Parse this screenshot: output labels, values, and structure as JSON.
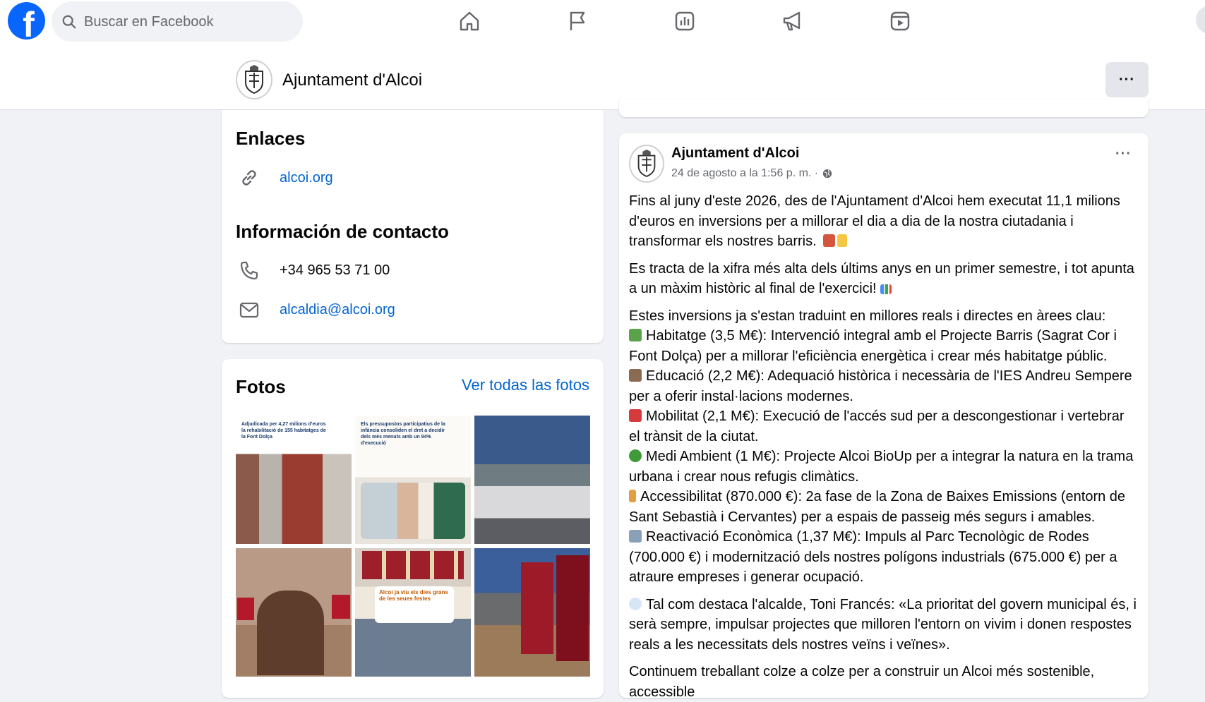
{
  "topbar": {
    "logo_letter": "f",
    "search_placeholder": "Buscar en Facebook",
    "nav_icons": [
      "home-icon",
      "flag-icon",
      "insights-icon",
      "megaphone-icon",
      "video-icon"
    ]
  },
  "page_header": {
    "name": "Ajuntament d'Alcoi",
    "more_label": "···"
  },
  "links_card": {
    "title": "Enlaces",
    "website": "alcoi.org",
    "contact_title": "Información de contacto",
    "phone": "+34 965 53 71 00",
    "email": "alcaldia@alcoi.org"
  },
  "photos_card": {
    "title": "Fotos",
    "see_all": "Ver todas las fotos",
    "photos": [
      {
        "caption": "Adjudicada per 4,27 milions d'euros la rehabilitació de 155 habitatges de la Font Dolça"
      },
      {
        "caption": "Els pressupostos participatius de la infància consoliden el dret a decidir dels més menuts amb un 94% d'execució"
      },
      {
        "caption": ""
      },
      {
        "caption": ""
      },
      {
        "caption": "Alcoi ja viu els dies grans de les seues festes"
      },
      {
        "caption": ""
      }
    ]
  },
  "post": {
    "author": "Ajuntament d'Alcoi",
    "date": "24 de agosto a la 1:56 p. m. ·",
    "more_label": "···",
    "paragraph1": "Fins al juny d'este 2026, des de l'Ajuntament d'Alcoi hem executat 11,1 milions d'euros en inversions per a millorar el dia a dia de la nostra ciutadania i transformar els nostres barris.",
    "paragraph2": "Es tracta de la xifra més alta dels últims anys en un primer semestre, i tot apunta a un màxim històric al final de l'exercici!",
    "intro": "Estes inversions ja s'estan traduint en millores reals i directes en àrees clau:",
    "items": [
      {
        "emoji": "house-emoji",
        "text": "Habitatge (3,5 M€): Intervenció integral amb el Projecte Barris (Sagrat Cor i Font Dolça) per a millorar l'eficiència energètica i crear més habitatge públic."
      },
      {
        "emoji": "books-emoji",
        "text": "Educació (2,2 M€): Adequació històrica i necessària de l'IES Andreu Sempere per a oferir instal·lacions modernes."
      },
      {
        "emoji": "car-emoji",
        "text": "Mobilitat (2,1 M€): Execució de l'accés sud per a descongestionar i vertebrar el trànsit de la ciutat."
      },
      {
        "emoji": "tree-emoji",
        "text": "Medi Ambient (1 M€): Projecte Alcoi BioUp per a integrar la natura en la trama urbana i crear nous refugis climàtics."
      },
      {
        "emoji": "walking-emoji",
        "text": "Accessibilitat (870.000 €): 2a fase de la Zona de Baixes Emissions (entorn de Sant Sebastià i Cervantes) per a espais de passeig més segurs i amables."
      },
      {
        "emoji": "factory-emoji",
        "text": "Reactivació Econòmica (1,37 M€): Impuls al Parc Tecnològic de Rodes (700.000 €) i modernització dels nostres polígons industrials (675.000 €) per a atraure empreses i generar ocupació."
      }
    ],
    "quote": "Tal com destaca l'alcalde, Toni Francés: «La prioritat del govern municipal és, i serà sempre, impulsar projectes que milloren l'entorn on vivim i donen respostes reals a les necessitats dels nostres veïns i veïnes».",
    "closing": "Continuem treballant colze a colze per a construir un Alcoi més sostenible, accessible"
  },
  "colors": {
    "brand": "#0866ff",
    "link": "#0064d1",
    "background": "#f0f2f5"
  }
}
